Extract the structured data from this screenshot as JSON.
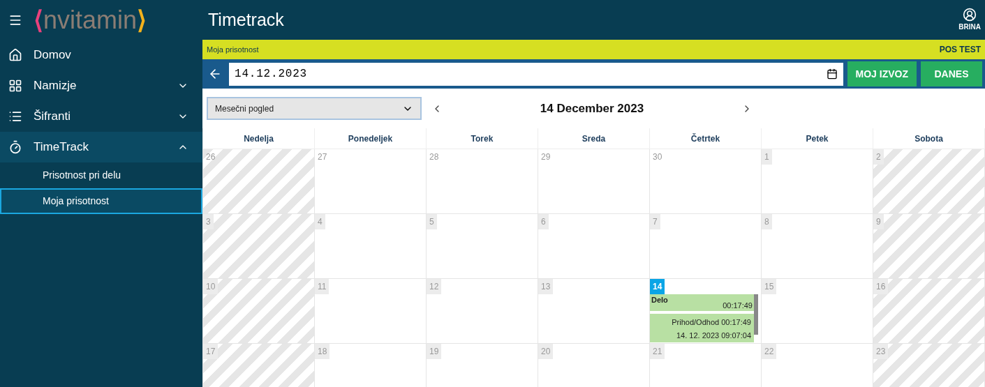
{
  "sidebar": {
    "logo": {
      "left": "⟨",
      "text": "nvitamin",
      "right": "⟩"
    },
    "items": [
      {
        "label": "Domov"
      },
      {
        "label": "Namizje",
        "expanded": false
      },
      {
        "label": "Šifranti",
        "expanded": false
      },
      {
        "label": "TimeTrack",
        "expanded": true,
        "children": [
          {
            "label": "Prisotnost pri delu",
            "selected": false
          },
          {
            "label": "Moja prisotnost",
            "selected": true
          }
        ]
      }
    ]
  },
  "header": {
    "title": "Timetrack",
    "user": "BRINA"
  },
  "breadcrumb": {
    "label": "Moja prisotnost",
    "env": "POS TEST"
  },
  "date_bar": {
    "value": "14.12.2023",
    "buttons": [
      "MOJ IZVOZ",
      "DANES"
    ]
  },
  "toolbar": {
    "view": "Mesečni pogled",
    "title": "14 December 2023"
  },
  "calendar": {
    "weekdays": [
      "Nedelja",
      "Ponedeljek",
      "Torek",
      "Sreda",
      "Četrtek",
      "Petek",
      "Sobota"
    ],
    "weeks": [
      [
        {
          "day": "26",
          "other_month": true,
          "today": false
        },
        {
          "day": "27",
          "other_month": true,
          "today": false
        },
        {
          "day": "28",
          "other_month": true,
          "today": false
        },
        {
          "day": "29",
          "other_month": true,
          "today": false
        },
        {
          "day": "30",
          "other_month": true,
          "today": false
        },
        {
          "day": "1",
          "other_month": false,
          "today": false
        },
        {
          "day": "2",
          "other_month": false,
          "today": false
        }
      ],
      [
        {
          "day": "3",
          "other_month": false,
          "today": false
        },
        {
          "day": "4",
          "other_month": false,
          "today": false
        },
        {
          "day": "5",
          "other_month": false,
          "today": false
        },
        {
          "day": "6",
          "other_month": false,
          "today": false
        },
        {
          "day": "7",
          "other_month": false,
          "today": false
        },
        {
          "day": "8",
          "other_month": false,
          "today": false
        },
        {
          "day": "9",
          "other_month": false,
          "today": false
        }
      ],
      [
        {
          "day": "10",
          "other_month": false,
          "today": false
        },
        {
          "day": "11",
          "other_month": false,
          "today": false
        },
        {
          "day": "12",
          "other_month": false,
          "today": false
        },
        {
          "day": "13",
          "other_month": false,
          "today": false
        },
        {
          "day": "14",
          "other_month": false,
          "today": true,
          "events": [
            {
              "kind": "summary",
              "label": "Delo",
              "time": "00:17:49"
            },
            {
              "kind": "detail",
              "lines": [
                "Prihod/Odhod 00:17:49",
                "14. 12. 2023 09:07:04"
              ]
            }
          ]
        },
        {
          "day": "15",
          "other_month": false,
          "today": false
        },
        {
          "day": "16",
          "other_month": false,
          "today": false
        }
      ],
      [
        {
          "day": "17",
          "other_month": false,
          "today": false
        },
        {
          "day": "18",
          "other_month": false,
          "today": false
        },
        {
          "day": "19",
          "other_month": false,
          "today": false
        },
        {
          "day": "20",
          "other_month": false,
          "today": false
        },
        {
          "day": "21",
          "other_month": false,
          "today": false
        },
        {
          "day": "22",
          "other_month": false,
          "today": false
        },
        {
          "day": "23",
          "other_month": false,
          "today": false
        }
      ]
    ]
  }
}
